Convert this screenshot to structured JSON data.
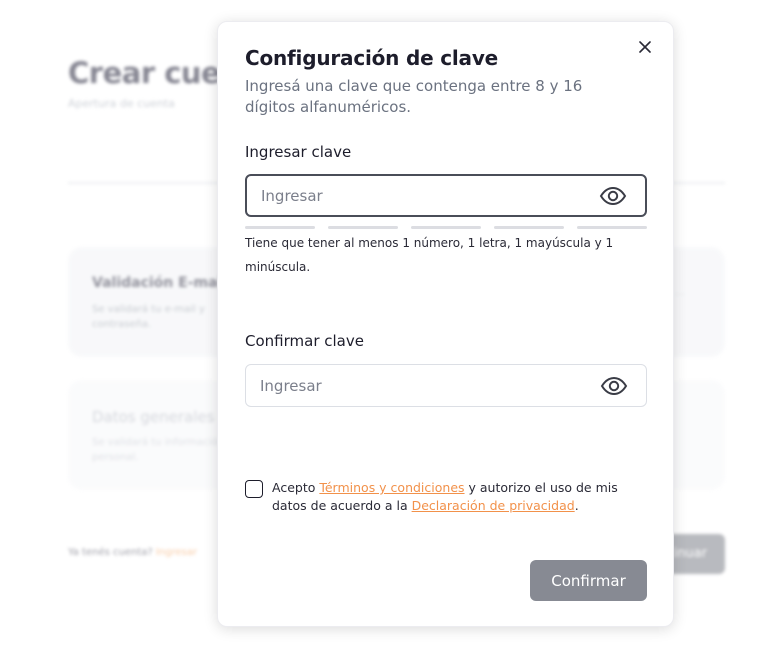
{
  "background": {
    "title": "Crear cuenta",
    "subtitle": "Apertura de cuenta",
    "card1": {
      "title": "Validación E-mail",
      "text": "Se validará tu e-mail y contraseña.",
      "dots": "..."
    },
    "card2": {
      "title": "Datos generales",
      "text": "Se validará tu información personal."
    },
    "question": "Ya tenés cuenta?",
    "question_link": "Ingresar",
    "next_button": "Continuar"
  },
  "modal": {
    "title": "Configuración de clave",
    "description": "Ingresá una clave que contenga entre 8 y 16 dígitos alfanuméricos.",
    "password_label": "Ingresar clave",
    "password_placeholder": "Ingresar",
    "password_value": "",
    "strength_segments": 5,
    "hint": "Tiene que tener al menos 1 número, 1 letra, 1 mayúscula y 1 minúscula.",
    "confirm_label": "Confirmar clave",
    "confirm_placeholder": "Ingresar",
    "confirm_value": "",
    "terms": {
      "checked": false,
      "prefix": "Acepto ",
      "terms_link": "Términos y condiciones",
      "middle": " y autorizo el uso de mis datos de acuerdo a la ",
      "privacy_link": "Declaración de privacidad",
      "suffix": "."
    },
    "confirm_button": "Confirmar",
    "icons": {
      "close": "close-icon",
      "eye": "eye-icon"
    }
  },
  "colors": {
    "primary_button": "#878a93",
    "link": "#f2914a",
    "active_border": "#4a4d58"
  }
}
